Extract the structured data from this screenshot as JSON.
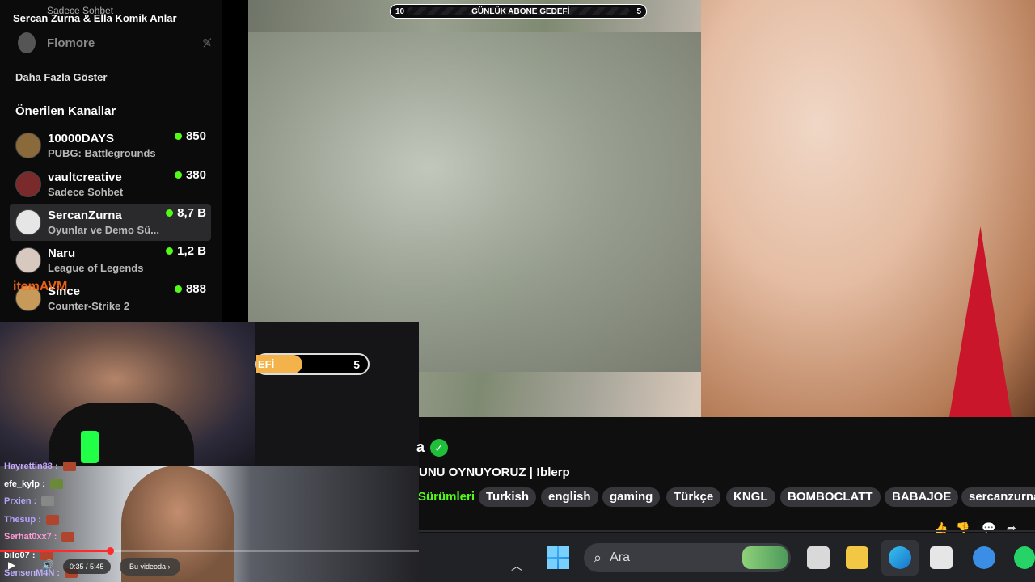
{
  "goal_bar": {
    "left": "10",
    "label": "GÜNLÜK ABONE GEDEFİ",
    "right": "5"
  },
  "sidebar": {
    "top_item_sub": "Sadece Sohbet",
    "top_item_title": "Sercan Zurna & Ella Komik Anlar",
    "offline_channel": "Flomore",
    "show_more": "Daha Fazla Göster",
    "recommended_title": "Önerilen Kanallar",
    "channels": [
      {
        "name": "10000DAYS",
        "category": "PUBG: Battlegrounds",
        "viewers": "850"
      },
      {
        "name": "vaultcreative",
        "category": "Sadece Sohbet",
        "viewers": "380"
      },
      {
        "name": "SercanZurna",
        "category": "Oyunlar ve Demo Sü...",
        "viewers": "8,7 B"
      },
      {
        "name": "Naru",
        "category": "League of Legends",
        "viewers": "1,2 B"
      },
      {
        "name": "Since",
        "category": "Counter-Strike 2",
        "viewers": "888"
      }
    ],
    "overlay_brand": "itemAVM"
  },
  "subgoal": {
    "left": "EFİ",
    "right": "5"
  },
  "chat": [
    {
      "user": "Hayrettin88 :",
      "color": "#c8a7ff"
    },
    {
      "user": "efe_kylp :",
      "color": "#ffffff"
    },
    {
      "user": "Prxien :",
      "color": "#b7a6ff"
    },
    {
      "user": "Thesup :",
      "color": "#b9a1ff"
    },
    {
      "user": "Serhat0xx7 :",
      "color": "#ff9ad5"
    },
    {
      "user": "bilo07 :",
      "color": "#ffffff"
    },
    {
      "user": "SensenM4N :",
      "color": "#c0b0ff"
    }
  ],
  "player": {
    "time": "0:35 / 5:45",
    "in_video": "Bu videoda ›",
    "progress": 0.26
  },
  "stream": {
    "name_tail": "a",
    "title": "UNU OYNUYORUZ | !blerp",
    "category": "Sürümleri",
    "tags": [
      "Turkish",
      "english",
      "gaming",
      "Türkçe",
      "KNGL",
      "BOMBOCLATT",
      "BABAJOE",
      "sercanzurna"
    ]
  },
  "taskbar": {
    "search_placeholder": "Ara"
  },
  "colors": {
    "live": "#53fc18",
    "verified": "#1fbf3a",
    "progress": "#ff2a2a"
  }
}
